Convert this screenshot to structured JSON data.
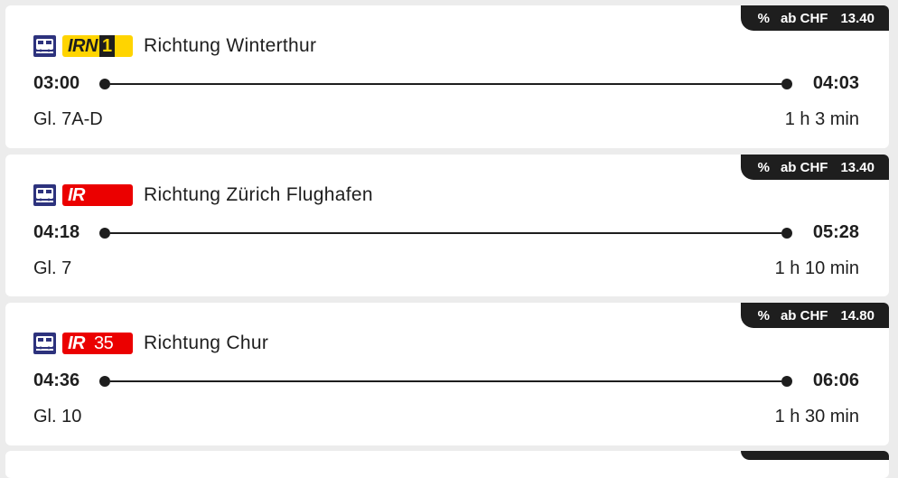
{
  "connections": [
    {
      "price": {
        "percent": "%",
        "prefix": "ab CHF",
        "amount": "13.40"
      },
      "product": {
        "code": "IRN",
        "number": "1",
        "type": "irn"
      },
      "direction": "Richtung Winterthur",
      "departure": "03:00",
      "arrival": "04:03",
      "platform": "Gl. 7A-D",
      "duration": "1 h 3 min"
    },
    {
      "price": {
        "percent": "%",
        "prefix": "ab CHF",
        "amount": "13.40"
      },
      "product": {
        "code": "IR",
        "number": "",
        "type": "ir"
      },
      "direction": "Richtung Zürich Flughafen",
      "departure": "04:18",
      "arrival": "05:28",
      "platform": "Gl. 7",
      "duration": "1 h 10 min"
    },
    {
      "price": {
        "percent": "%",
        "prefix": "ab CHF",
        "amount": "14.80"
      },
      "product": {
        "code": "IR",
        "number": "35",
        "type": "ir"
      },
      "direction": "Richtung Chur",
      "departure": "04:36",
      "arrival": "06:06",
      "platform": "Gl. 10",
      "duration": "1 h 30 min"
    }
  ],
  "icons": {
    "train": "train-icon"
  },
  "colors": {
    "ir_red": "#eb0000",
    "irn_yellow": "#ffd400",
    "dark": "#1e1e1e",
    "train_icon_blue": "#2d327d"
  }
}
